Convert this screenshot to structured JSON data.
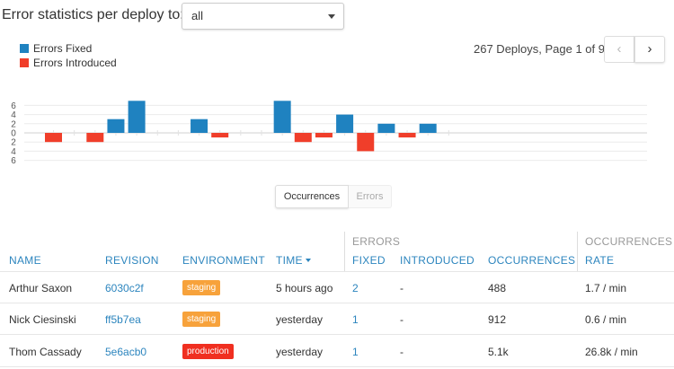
{
  "header": {
    "title": "Error statistics per deploy to:",
    "selected_env": "all"
  },
  "legend": [
    {
      "label": "Errors Fixed",
      "color": "#1f82c0"
    },
    {
      "label": "Errors Introduced",
      "color": "#f03e2a"
    }
  ],
  "pager": {
    "summary": "267 Deploys, Page 1 of 9",
    "prev_icon": "chevron-left-icon",
    "prev_label": "‹",
    "next_icon": "chevron-right-icon",
    "next_label": "›"
  },
  "chart_data": {
    "type": "bar",
    "stacked_diverging": true,
    "yticks": [
      "6",
      "4",
      "2",
      "0",
      "2",
      "4",
      "6"
    ],
    "ylim": [
      -6,
      6
    ],
    "grid": true,
    "legend_position": "top-left",
    "series": [
      {
        "name": "Errors Fixed",
        "color": "#1f82c0",
        "values": [
          0,
          0,
          0,
          3,
          7,
          0,
          0,
          3,
          0,
          0,
          0,
          7,
          0,
          0,
          4,
          0,
          2,
          0,
          2,
          0
        ]
      },
      {
        "name": "Errors Introduced",
        "color": "#f03e2a",
        "values": [
          2,
          0,
          2,
          0,
          0,
          0,
          0,
          0,
          1,
          0,
          0,
          0,
          2,
          1,
          0,
          4,
          0,
          1,
          0,
          0
        ]
      }
    ]
  },
  "toggle": {
    "occurrences": "Occurrences",
    "errors": "Errors"
  },
  "table": {
    "group_errors": "ERRORS",
    "group_occurrences": "OCCURRENCES",
    "columns": {
      "name": "NAME",
      "revision": "REVISION",
      "environment": "ENVIRONMENT",
      "time": "TIME",
      "fixed": "FIXED",
      "introduced": "INTRODUCED",
      "occurrences": "OCCURRENCES",
      "rate": "RATE"
    },
    "rows": [
      {
        "name": "Arthur Saxon",
        "revision": "6030c2f",
        "environment": "staging",
        "env_color": "#f7a23b",
        "time": "5 hours ago",
        "fixed": "2",
        "introduced": "-",
        "occurrences": "488",
        "rate": "1.7 / min"
      },
      {
        "name": "Nick Ciesinski",
        "revision": "ff5b7ea",
        "environment": "staging",
        "env_color": "#f7a23b",
        "time": "yesterday",
        "fixed": "1",
        "introduced": "-",
        "occurrences": "912",
        "rate": "0.6 / min"
      },
      {
        "name": "Thom Cassady",
        "revision": "5e6acb0",
        "environment": "production",
        "env_color": "#f02f20",
        "time": "yesterday",
        "fixed": "1",
        "introduced": "-",
        "occurrences": "5.1k",
        "rate": "26.8k / min"
      }
    ]
  }
}
